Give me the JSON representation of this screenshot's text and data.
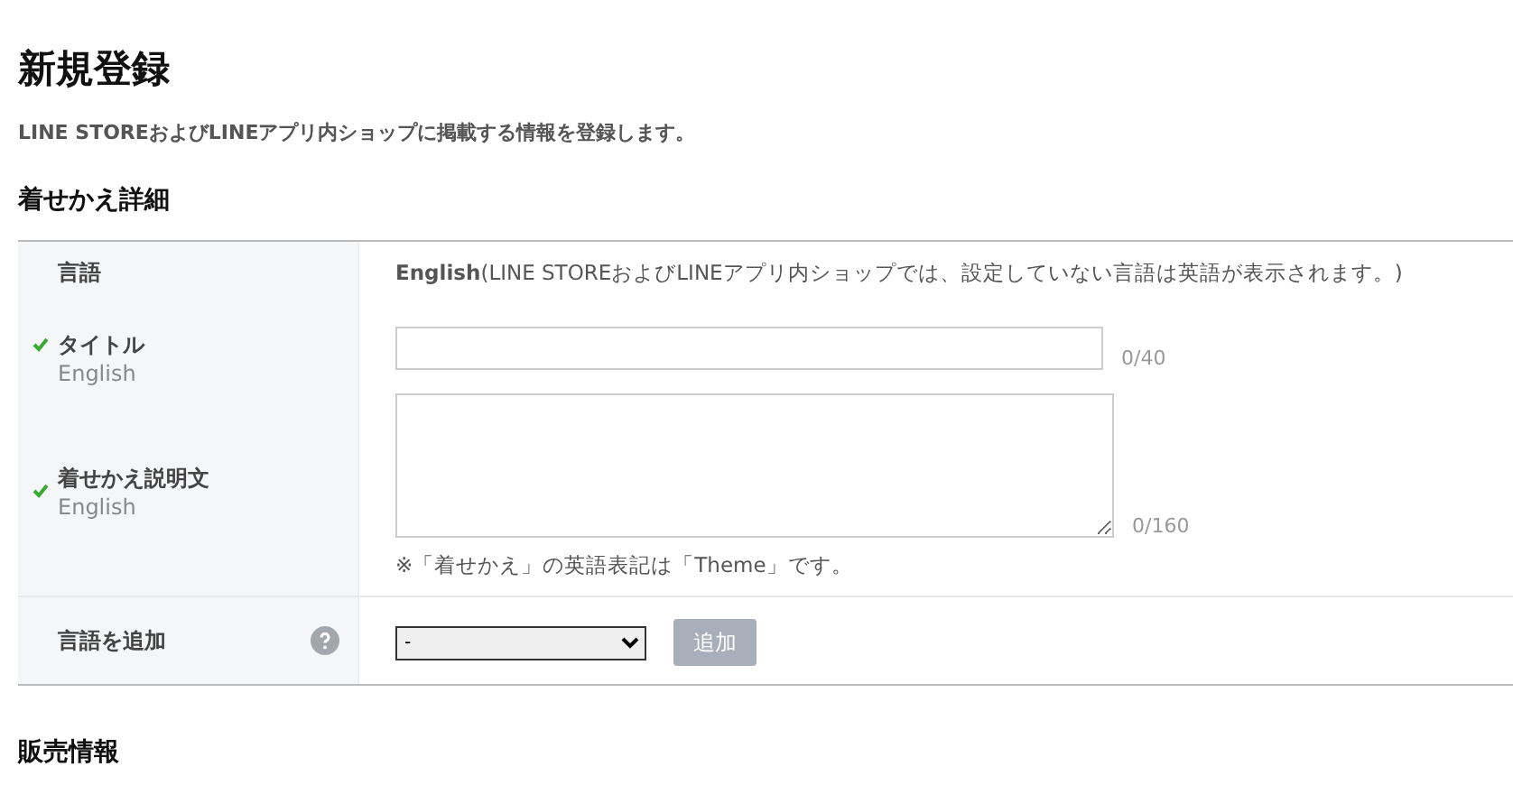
{
  "page_title": "新規登録",
  "intro": "LINE STOREおよびLINEアプリ内ショップに掲載する情報を登録します。",
  "section_title": "着せかえ詳細",
  "rows": [
    {
      "kind": "language",
      "label": "言語",
      "text": "**English**(LINE STOREおよびLINEアプリ内ショップでは、設定していない言語は英語が表示されます。)"
    },
    {
      "kind": "text",
      "label": "タイトル",
      "sublabel": "English",
      "required": true,
      "counter": "0/40"
    },
    {
      "kind": "textarea",
      "label": "着せかえ説明文",
      "sublabel": "English",
      "required": true,
      "counter": "0/160",
      "note": "※「着せかえ」の英語表記は「Theme」です。"
    },
    {
      "kind": "add",
      "label": "言語を追加",
      "help": true,
      "select_value": "-",
      "button": {
        "label": "追加",
        "disabled": true
      }
    }
  ],
  "next_section_title": "販売情報"
}
